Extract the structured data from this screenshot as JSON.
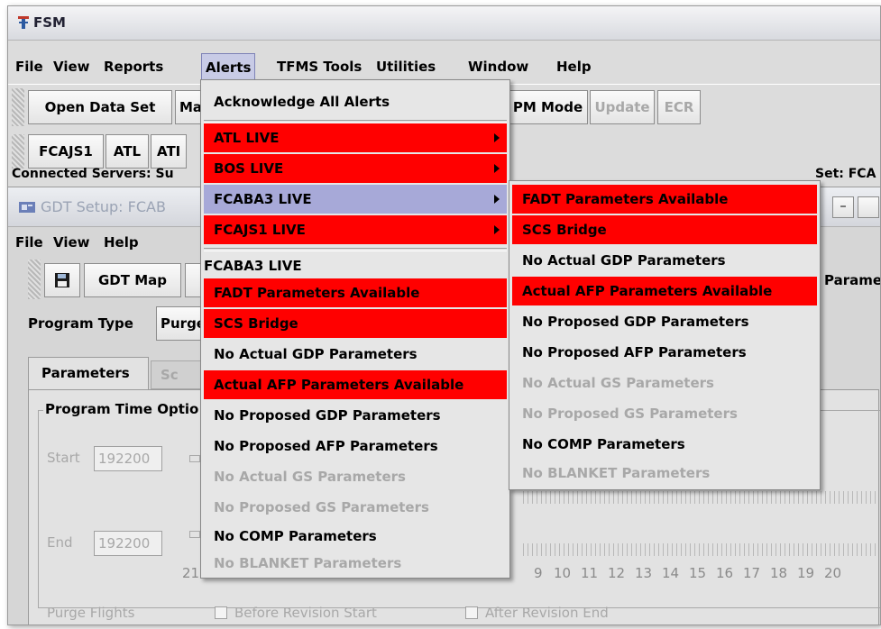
{
  "app": {
    "title": "FSM",
    "menu": [
      "File",
      "View",
      "Reports",
      "Alerts",
      "TFMS Tools",
      "Utilities",
      "Window",
      "Help"
    ],
    "toolbar": {
      "open_data_set": "Open Data Set",
      "map_partial": "Ma",
      "pm_mode": "PM Mode",
      "update": "Update",
      "ecr": "ECR"
    },
    "tabs_row": [
      "FCAJS1",
      "ATL",
      "ATI"
    ],
    "status_left": "Connected Servers: Su",
    "status_right": "Set: FCA"
  },
  "gdt": {
    "title": "GDT Setup: FCAB",
    "menu": [
      "File",
      "View",
      "Help"
    ],
    "save_icon": "floppy-icon",
    "gdt_map": "GDT Map",
    "params_partial": "Parame",
    "program_type_label": "Program Type",
    "program_type_value": "Purge",
    "tab_parameters": "Parameters",
    "tab_other_partial": "Sc",
    "group_time": "Program Time Optio",
    "start_label": "Start",
    "start_value": "192200",
    "end_label": "End",
    "end_value": "192200",
    "hour_21": "21",
    "hours": [
      "9",
      "10",
      "11",
      "12",
      "13",
      "14",
      "15",
      "16",
      "17",
      "18",
      "19",
      "20"
    ],
    "purge_flights": "Purge Flights",
    "before_revision": "Before Revision Start",
    "after_revision": "After Revision End"
  },
  "alerts_menu": {
    "acknowledge": "Acknowledge All Alerts",
    "servers": [
      {
        "label": "ATL LIVE",
        "state": "red"
      },
      {
        "label": "BOS LIVE",
        "state": "red"
      },
      {
        "label": "FCABA3 LIVE",
        "state": "selected"
      },
      {
        "label": "FCAJS1 LIVE",
        "state": "red"
      }
    ],
    "section_header": "FCABA3 LIVE",
    "items": [
      {
        "label": "FADT Parameters Available",
        "state": "red"
      },
      {
        "label": "SCS Bridge",
        "state": "red"
      },
      {
        "label": "No Actual GDP Parameters",
        "state": "normal"
      },
      {
        "label": "Actual AFP Parameters Available",
        "state": "red"
      },
      {
        "label": "No Proposed GDP Parameters",
        "state": "normal"
      },
      {
        "label": "No Proposed AFP Parameters",
        "state": "normal"
      },
      {
        "label": "No Actual GS Parameters",
        "state": "disabled"
      },
      {
        "label": "No Proposed GS Parameters",
        "state": "disabled"
      },
      {
        "label": "No COMP Parameters",
        "state": "normal"
      },
      {
        "label": "No BLANKET Parameters",
        "state": "disabled"
      }
    ]
  },
  "submenu": {
    "items": [
      {
        "label": "FADT Parameters Available",
        "state": "red"
      },
      {
        "label": "SCS Bridge",
        "state": "red"
      },
      {
        "label": "No Actual GDP Parameters",
        "state": "normal"
      },
      {
        "label": "Actual AFP Parameters Available",
        "state": "red"
      },
      {
        "label": "No Proposed GDP Parameters",
        "state": "normal"
      },
      {
        "label": "No Proposed AFP Parameters",
        "state": "normal"
      },
      {
        "label": "No Actual GS Parameters",
        "state": "disabled"
      },
      {
        "label": "No Proposed GS Parameters",
        "state": "disabled"
      },
      {
        "label": "No COMP Parameters",
        "state": "normal"
      },
      {
        "label": "No BLANKET Parameters",
        "state": "disabled"
      }
    ]
  },
  "colors": {
    "alert_red": "#ff0000",
    "selection": "#a7a9d8",
    "menu_bg": "#e6e6e6"
  }
}
